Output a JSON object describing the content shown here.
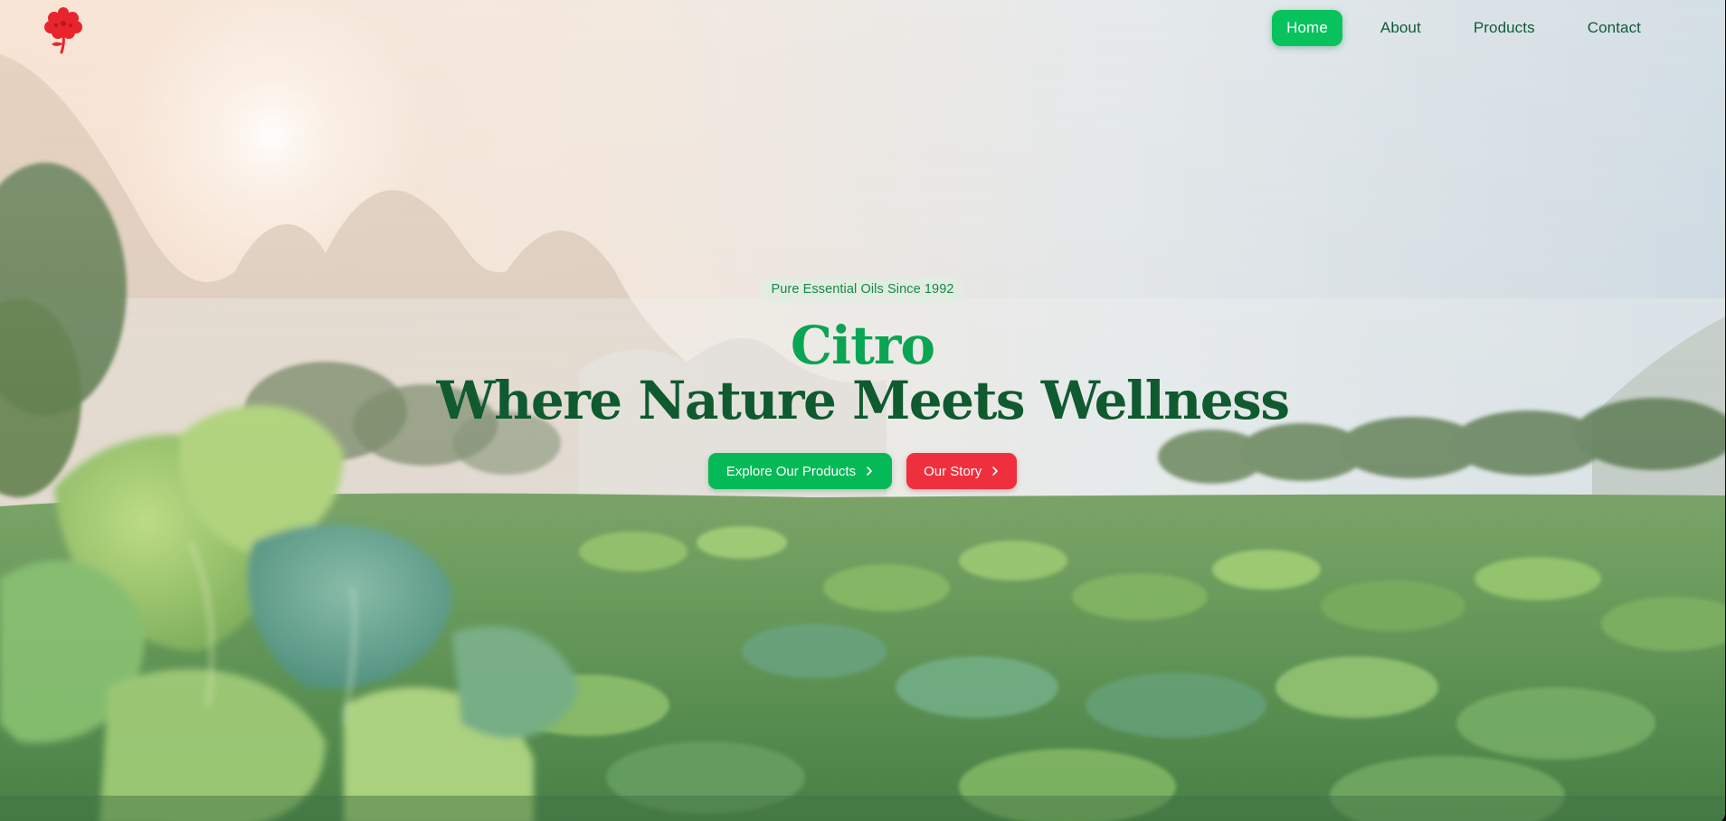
{
  "brand": {
    "logo_icon": "red-flower-logo-icon",
    "accent_green": "#08c35d",
    "accent_red": "#ef2f3e"
  },
  "nav": {
    "items": [
      {
        "label": "Home",
        "active": true
      },
      {
        "label": "About",
        "active": false
      },
      {
        "label": "Products",
        "active": false
      },
      {
        "label": "Contact",
        "active": false
      }
    ]
  },
  "hero": {
    "badge": "Pure Essential Oils Since 1992",
    "title": "Citro",
    "tagline": "Where Nature Meets Wellness",
    "primary_cta": "Explore Our Products",
    "secondary_cta": "Our Story",
    "cta_icon": "chevron-right-icon"
  }
}
